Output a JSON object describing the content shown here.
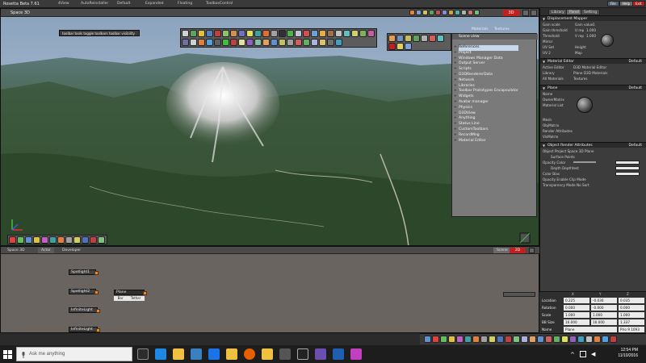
{
  "window": {
    "app_title": "Rosetta Beta 7.61",
    "menu": [
      "4View",
      "AutoReinstaller",
      "Default",
      "Expanded",
      "Floating",
      "ToolboxControl"
    ],
    "buttons": [
      "File",
      "Help",
      "Exit"
    ]
  },
  "viewport": {
    "label": "Space 3D",
    "mode_label": "3D",
    "toolbar_tooltip": "toolbar tools  toggle toolbars  toolbar visibility"
  },
  "scene_view": {
    "title": "Scene view",
    "tabs": [
      "Materials",
      "Textures"
    ],
    "items": [
      "References",
      "Project",
      "Windows Manager Data",
      "Output Server",
      "Scripts",
      "D3DRendererData",
      "Network",
      "Libraries",
      "Toolbar Prototypes Encapsulator",
      "Widgets",
      "Avatar manager",
      "Physics",
      "D3DView",
      "Anything",
      "Status Line",
      "CustomToolbars",
      "RecordMng",
      "Material Editor"
    ]
  },
  "node_editor": {
    "label": "Space 3D",
    "tabs": [
      "Actor",
      "Developer"
    ],
    "mode_label": "2D",
    "scene_btn": "Scene",
    "nodes": [
      "Spotlight1",
      "Spotlight2",
      "Plane",
      "InfiniteLight",
      "InfiniteLight"
    ],
    "node_ports": [
      "Bar",
      "Tether"
    ]
  },
  "right_panel": {
    "tabs": [
      "Library",
      "Panel",
      "Setting"
    ],
    "displacement": {
      "title": "Displacement Mapper",
      "rows": [
        {
          "l": "Gain scale",
          "r": "Gain value",
          "rv": "1"
        },
        {
          "l": "Gain threshold",
          "r": "U rep",
          "rv": "1.000"
        },
        {
          "l": "Threshold",
          "r": "V rep",
          "rv": "1.000"
        },
        {
          "l": "Mirror",
          "r": "",
          "rv": ""
        },
        {
          "l": "UV Set",
          "r": "Height",
          "rv": ""
        },
        {
          "l": "UV 2",
          "r": "Map",
          "rv": ""
        }
      ]
    },
    "material_editor": {
      "title": "Material Editor",
      "default_label": "Default",
      "rows": [
        {
          "l": "Active Editor",
          "v": "D3D Material Editor"
        },
        {
          "l": "Library",
          "v": "Plane   D3D Materials"
        },
        {
          "l": "All Materials",
          "v": "Textures"
        }
      ]
    },
    "plane": {
      "title": "Plane",
      "default_label": "Default",
      "items": [
        "Name",
        "OwnerMatrix",
        "Material List",
        "Mesh",
        "ObjMatrix",
        "Render Attributes",
        "VisMatrix"
      ]
    },
    "render_attrs": {
      "title": "Object Render Attributes",
      "default_label": "Default",
      "rows": [
        "Object  Project Space  3D Plane",
        "Surface   Points",
        "Opacity   Color",
        "Depth   Depthtest",
        "Color   Bias",
        "Opacity   Enable Clip Mode",
        "Transparency Mode   No Sort"
      ]
    },
    "transform": {
      "cols": [
        "X",
        "Y",
        "Z"
      ],
      "rows": [
        {
          "k": "Location",
          "x": "0.225",
          "y": "-0.036",
          "z": "0.035"
        },
        {
          "k": "Rotation",
          "x": "0.000",
          "y": "-0.000",
          "z": "0.000"
        },
        {
          "k": "Scale",
          "x": "1.000",
          "y": "1.000",
          "z": "1.000"
        },
        {
          "k": "BB Size",
          "x": "16.000",
          "y": "16.000",
          "z": "1.337"
        },
        {
          "k": "Name",
          "x": "Plane",
          "y": "",
          "z": "Prio 9  1093"
        }
      ]
    }
  },
  "taskbar": {
    "search_placeholder": "Ask me anything",
    "time": "12:54 PM",
    "date": "11/10/2016",
    "icons": [
      "task-view-icon",
      "edge-icon",
      "file-explorer-icon",
      "store-icon",
      "dropbox-icon",
      "folder-icon",
      "firefox-icon",
      "explorer-icon",
      "app-icon",
      "unity-icon",
      "app2-icon",
      "visual-studio-icon",
      "app3-icon"
    ],
    "icon_colors": [
      "#2c2c2c",
      "#1e88e5",
      "#f0c040",
      "#3a80c0",
      "#1a73e8",
      "#f0c040",
      "#e66000",
      "#f0c040",
      "#555555",
      "#222222",
      "#6a4fb0",
      "#1f5fb0",
      "#c040c0"
    ]
  },
  "colors": {
    "accent_orange": "#e48a2a",
    "red_mode": "#c02020",
    "panel_bg": "#3c3c3c"
  }
}
